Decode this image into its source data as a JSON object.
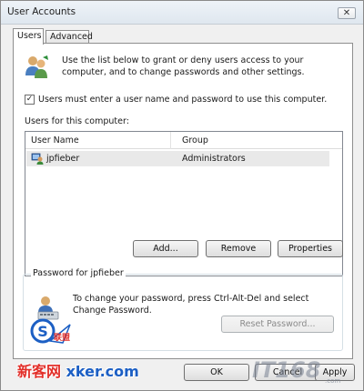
{
  "window": {
    "title": "User Accounts",
    "close_glyph": "✕"
  },
  "tabs": [
    {
      "label": "Users",
      "active": true
    },
    {
      "label": "Advanced",
      "active": false
    }
  ],
  "intro": {
    "icon": "users-icon",
    "text": "Use the list below to grant or deny users access to your computer, and to change passwords and other settings."
  },
  "require_login": {
    "checked": true,
    "check_glyph": "✓",
    "label": "Users must enter a user name and password to use this computer."
  },
  "users_section": {
    "label": "Users for this computer:",
    "columns": [
      "User Name",
      "Group"
    ],
    "rows": [
      {
        "icon": "user-icon",
        "user_name": "jpfieber",
        "group": "Administrators"
      }
    ]
  },
  "buttons": {
    "add": "Add...",
    "remove": "Remove",
    "properties": "Properties",
    "ok": "OK",
    "cancel": "Cancel",
    "apply": "Apply"
  },
  "password_group": {
    "legend": "Password for jpfieber",
    "icon": "password-keyboard-icon",
    "text": "To change your password, press Ctrl-Alt-Del and select Change Password.",
    "reset_button": "Reset Password..."
  },
  "watermarks": {
    "left_cn": "新客网",
    "left_en": "xker.com",
    "logo_text": "联盟",
    "right": "IT168",
    "right_sub": ".com"
  },
  "colors": {
    "accent_red": "#e2302a",
    "accent_blue": "#1c5fc4",
    "selection_bg": "#e9e9e9"
  }
}
